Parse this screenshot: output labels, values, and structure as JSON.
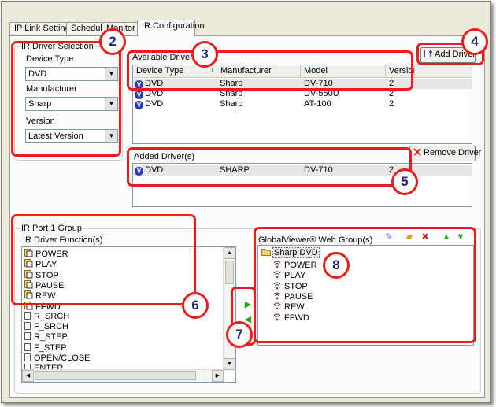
{
  "tabs": [
    {
      "label": "IP Link Settings"
    },
    {
      "label": "Schedule"
    },
    {
      "label": "Monitor"
    },
    {
      "label": "IR Configuration"
    }
  ],
  "ir_driver_selection": {
    "title": "IR Driver Selection",
    "device_type_label": "Device Type",
    "device_type_value": "DVD",
    "manufacturer_label": "Manufacturer",
    "manufacturer_value": "Sharp",
    "version_label": "Version",
    "version_value": "Latest Version"
  },
  "available_drivers": {
    "title": "Available Drivers",
    "add_button": "Add Driver",
    "columns": [
      "Device Type",
      "Manufacturer",
      "Model",
      "Version"
    ],
    "rows": [
      {
        "device_type": "DVD",
        "manufacturer": "Sharp",
        "model": "DV-710",
        "version": "2"
      },
      {
        "device_type": "DVD",
        "manufacturer": "Sharp",
        "model": "DV-550U",
        "version": "2"
      },
      {
        "device_type": "DVD",
        "manufacturer": "Sharp",
        "model": "AT-100",
        "version": "2"
      }
    ]
  },
  "added_drivers": {
    "title": "Added Driver(s)",
    "remove_button": "Remove Driver",
    "rows": [
      {
        "device_type": "DVD",
        "manufacturer": "SHARP",
        "model": "DV-710",
        "version": "2"
      }
    ]
  },
  "ir_port_group": {
    "title": "IR Port 1 Group",
    "functions_label": "IR Driver Function(s)",
    "functions": [
      "POWER",
      "PLAY",
      "STOP",
      "PAUSE",
      "REW",
      "FFWD",
      "R_SRCH",
      "F_SRCH",
      "R_STEP",
      "F_STEP",
      "OPEN/CLOSE",
      "ENTER"
    ],
    "mapped_count": 6
  },
  "web_group": {
    "title": "GlobalViewer® Web Group(s)",
    "root": "Sharp DVD",
    "children": [
      "POWER",
      "PLAY",
      "STOP",
      "PAUSE",
      "REW",
      "FFWD"
    ]
  },
  "callouts": [
    "2",
    "3",
    "4",
    "5",
    "6",
    "7",
    "8"
  ],
  "colors": {
    "callout_red": "#e81e1e",
    "callout_text": "#1e2a6e",
    "accent_green": "#2aa02a"
  }
}
